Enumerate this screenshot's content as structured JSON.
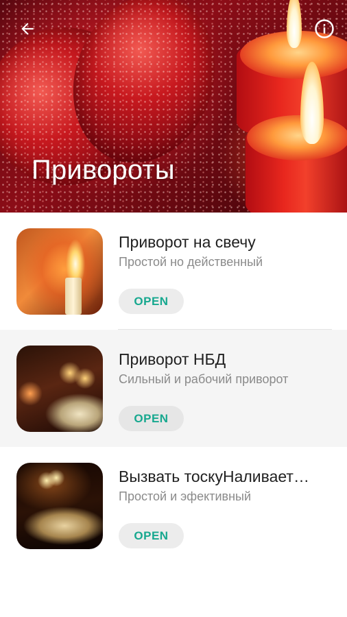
{
  "header": {
    "title": "Привороты",
    "back_icon": "arrow-left-icon",
    "info_icon": "info-circle-icon"
  },
  "items": [
    {
      "title": "Приворот на свечу",
      "subtitle": "Простой но действенный",
      "button_label": "OPEN"
    },
    {
      "title": "Приворот НБД",
      "subtitle": "Сильный и рабочий приворот",
      "button_label": "OPEN"
    },
    {
      "title": "Вызвать тоскуНаливает…",
      "subtitle": "Простой и эфективный",
      "button_label": "OPEN"
    }
  ],
  "colors": {
    "accent": "#17a88f",
    "title_text": "#212121",
    "subtitle_text": "#8a8a8a",
    "button_bg": "#ececec"
  }
}
